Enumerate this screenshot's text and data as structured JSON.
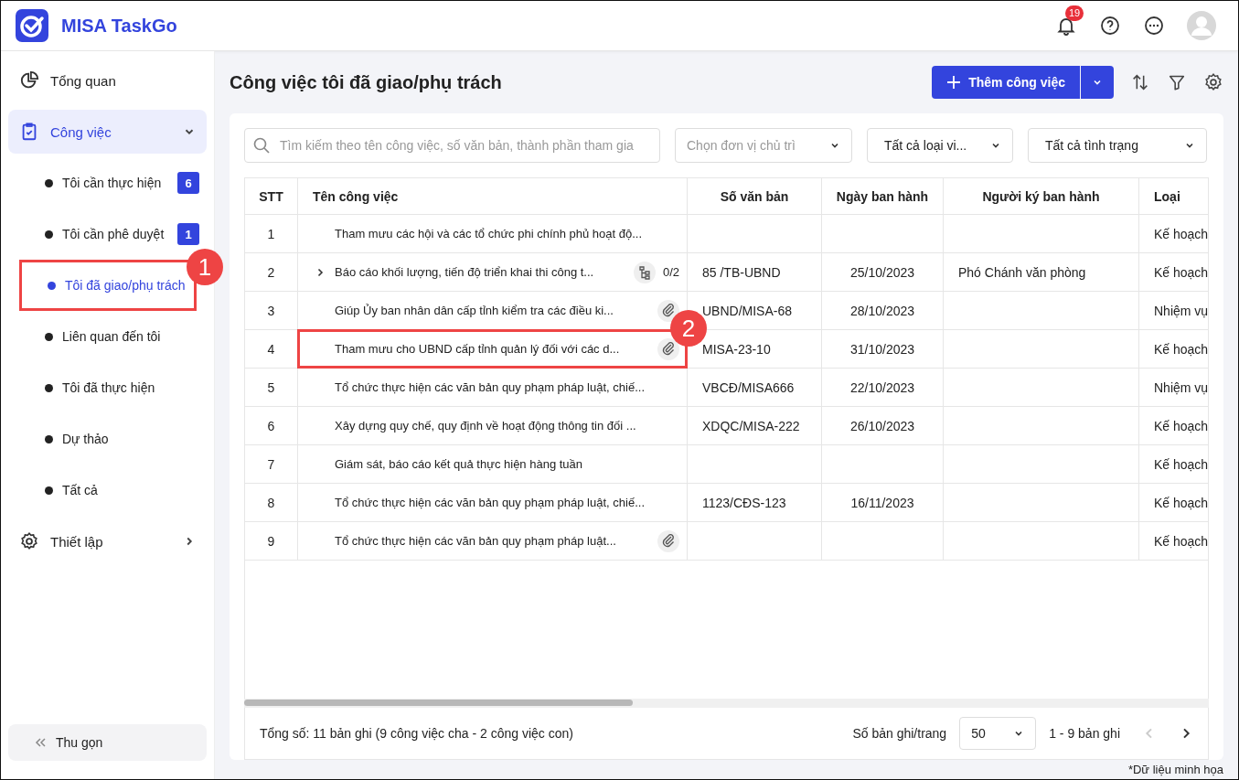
{
  "app": {
    "name": "MISA TaskGo"
  },
  "header": {
    "notification_count": "19"
  },
  "sidebar": {
    "overview": {
      "label": "Tổng quan"
    },
    "work": {
      "label": "Công việc",
      "selected": true,
      "expanded": true,
      "children": [
        {
          "label": "Tôi cần thực hiện",
          "count": "6",
          "selected": false
        },
        {
          "label": "Tôi cần phê duyệt",
          "count": "1",
          "selected": false
        },
        {
          "label": "Tôi đã giao/phụ trách",
          "selected": true,
          "callout": "1"
        },
        {
          "label": "Liên quan đến tôi",
          "selected": false
        },
        {
          "label": "Tôi đã thực hiện",
          "selected": false
        },
        {
          "label": "Dự thảo",
          "selected": false
        },
        {
          "label": "Tất cả",
          "selected": false
        }
      ]
    },
    "settings": {
      "label": "Thiết lập",
      "expanded": false
    },
    "collapse_button": "Thu gọn"
  },
  "page": {
    "title": "Công việc tôi đã giao/phụ trách",
    "add_button": "Thêm công việc"
  },
  "filters": {
    "search": {
      "placeholder": "Tìm kiếm theo tên công việc, số văn bản, thành phần tham gia"
    },
    "dropdowns": [
      {
        "placeholder": "Chọn đơn vị chủ trì"
      },
      {
        "value": "Tất cả loại vi..."
      },
      {
        "value": "Tất cả tình trạng"
      }
    ]
  },
  "table": {
    "columns": [
      "STT",
      "Tên công việc",
      "Số văn bản",
      "Ngày ban hành",
      "Người ký ban hành",
      "Loại"
    ],
    "rows": [
      {
        "stt": "1",
        "name": "Tham mưu các hội và các tổ chức phi chính phủ hoạt độ...",
        "doc_no": "",
        "date": "",
        "signer": "",
        "type": "Kế hoạch"
      },
      {
        "stt": "2",
        "name": "Báo cáo khối lượng, tiến độ triển khai thi công t...",
        "expandable": true,
        "subtasks": "0/2",
        "doc_no": "85 /TB-UBND",
        "date": "25/10/2023",
        "signer": "Phó Chánh văn phòng",
        "type": "Kế hoạch"
      },
      {
        "stt": "3",
        "name": "Giúp Ủy ban nhân dân cấp tỉnh kiểm tra các điều ki...",
        "attachment": true,
        "doc_no": "UBND/MISA-68",
        "date": "28/10/2023",
        "signer": "",
        "type": "Nhiệm vụ"
      },
      {
        "stt": "4",
        "name": "Tham mưu cho UBND cấp tỉnh quản lý đối với các d...",
        "attachment": true,
        "callout": "2",
        "doc_no": "MISA-23-10",
        "date": "31/10/2023",
        "signer": "",
        "type": "Kế hoạch"
      },
      {
        "stt": "5",
        "name": "Tổ chức thực hiện các văn bản quy phạm pháp luật, chiế...",
        "doc_no": "VBCĐ/MISA666",
        "date": "22/10/2023",
        "signer": "",
        "type": "Nhiệm vụ"
      },
      {
        "stt": "6",
        "name": "Xây dựng quy chế, quy định về hoạt động thông tin đối ...",
        "doc_no": "XDQC/MISA-222",
        "date": "26/10/2023",
        "signer": "",
        "type": "Kế hoạch"
      },
      {
        "stt": "7",
        "name": "Giám sát, báo cáo kết quả thực hiện hàng tuần",
        "doc_no": "",
        "date": "",
        "signer": "",
        "type": "Kế hoạch"
      },
      {
        "stt": "8",
        "name": "Tổ chức thực hiện các văn bản quy phạm pháp luật, chiế...",
        "doc_no": "1123/CĐS-123",
        "date": "16/11/2023",
        "signer": "",
        "type": "Kế hoạch"
      },
      {
        "stt": "9",
        "name": "Tổ chức thực hiện các văn bản quy phạm pháp luật...",
        "attachment": true,
        "doc_no": "",
        "date": "",
        "signer": "",
        "type": "Kế hoạch"
      }
    ]
  },
  "footer": {
    "total": "Tổng số: 11 bản ghi (9 công việc cha - 2 công việc con)",
    "page_size_label": "Số bản ghi/trang",
    "page_size": "50",
    "range": "1 - 9 bản ghi",
    "prev_disabled": true,
    "next_disabled": false
  },
  "note": "*Dữ liệu minh họa"
}
